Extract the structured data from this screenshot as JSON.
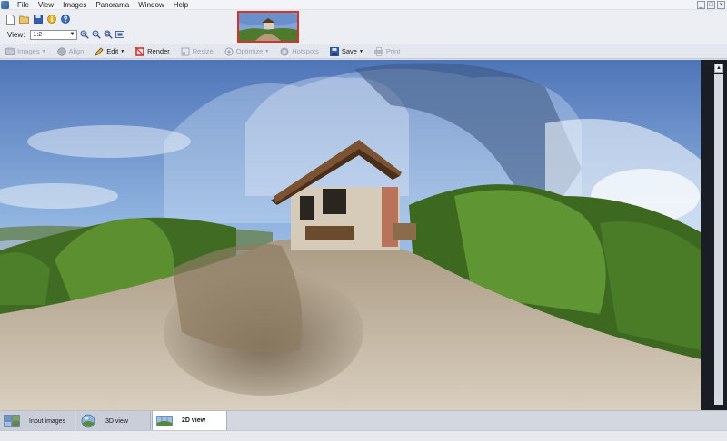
{
  "menu": {
    "items": [
      "File",
      "View",
      "Images",
      "Panorama",
      "Window",
      "Help"
    ]
  },
  "window_controls": {
    "minimize": "_",
    "maximize": "□",
    "close": "×"
  },
  "view": {
    "label": "View:",
    "zoom_value": "1:2"
  },
  "toolbar": {
    "images": "Images",
    "align": "Align",
    "edit": "Edit",
    "render": "Render",
    "resize": "Resize",
    "optimize": "Optimize",
    "hotspots": "Hotspots",
    "save": "Save",
    "print": "Print"
  },
  "tabs": {
    "input_images": "Input images",
    "view_3d": "3D view",
    "view_2d": "2D view"
  },
  "colors": {
    "accent_red": "#d1342c",
    "save_blue": "#2f5fb0",
    "toolbar_bg": "#e4e7ee"
  },
  "icons": {
    "new": "new-file-icon",
    "open": "open-folder-icon",
    "save": "floppy-disk-icon",
    "info": "info-icon",
    "help": "help-icon"
  }
}
